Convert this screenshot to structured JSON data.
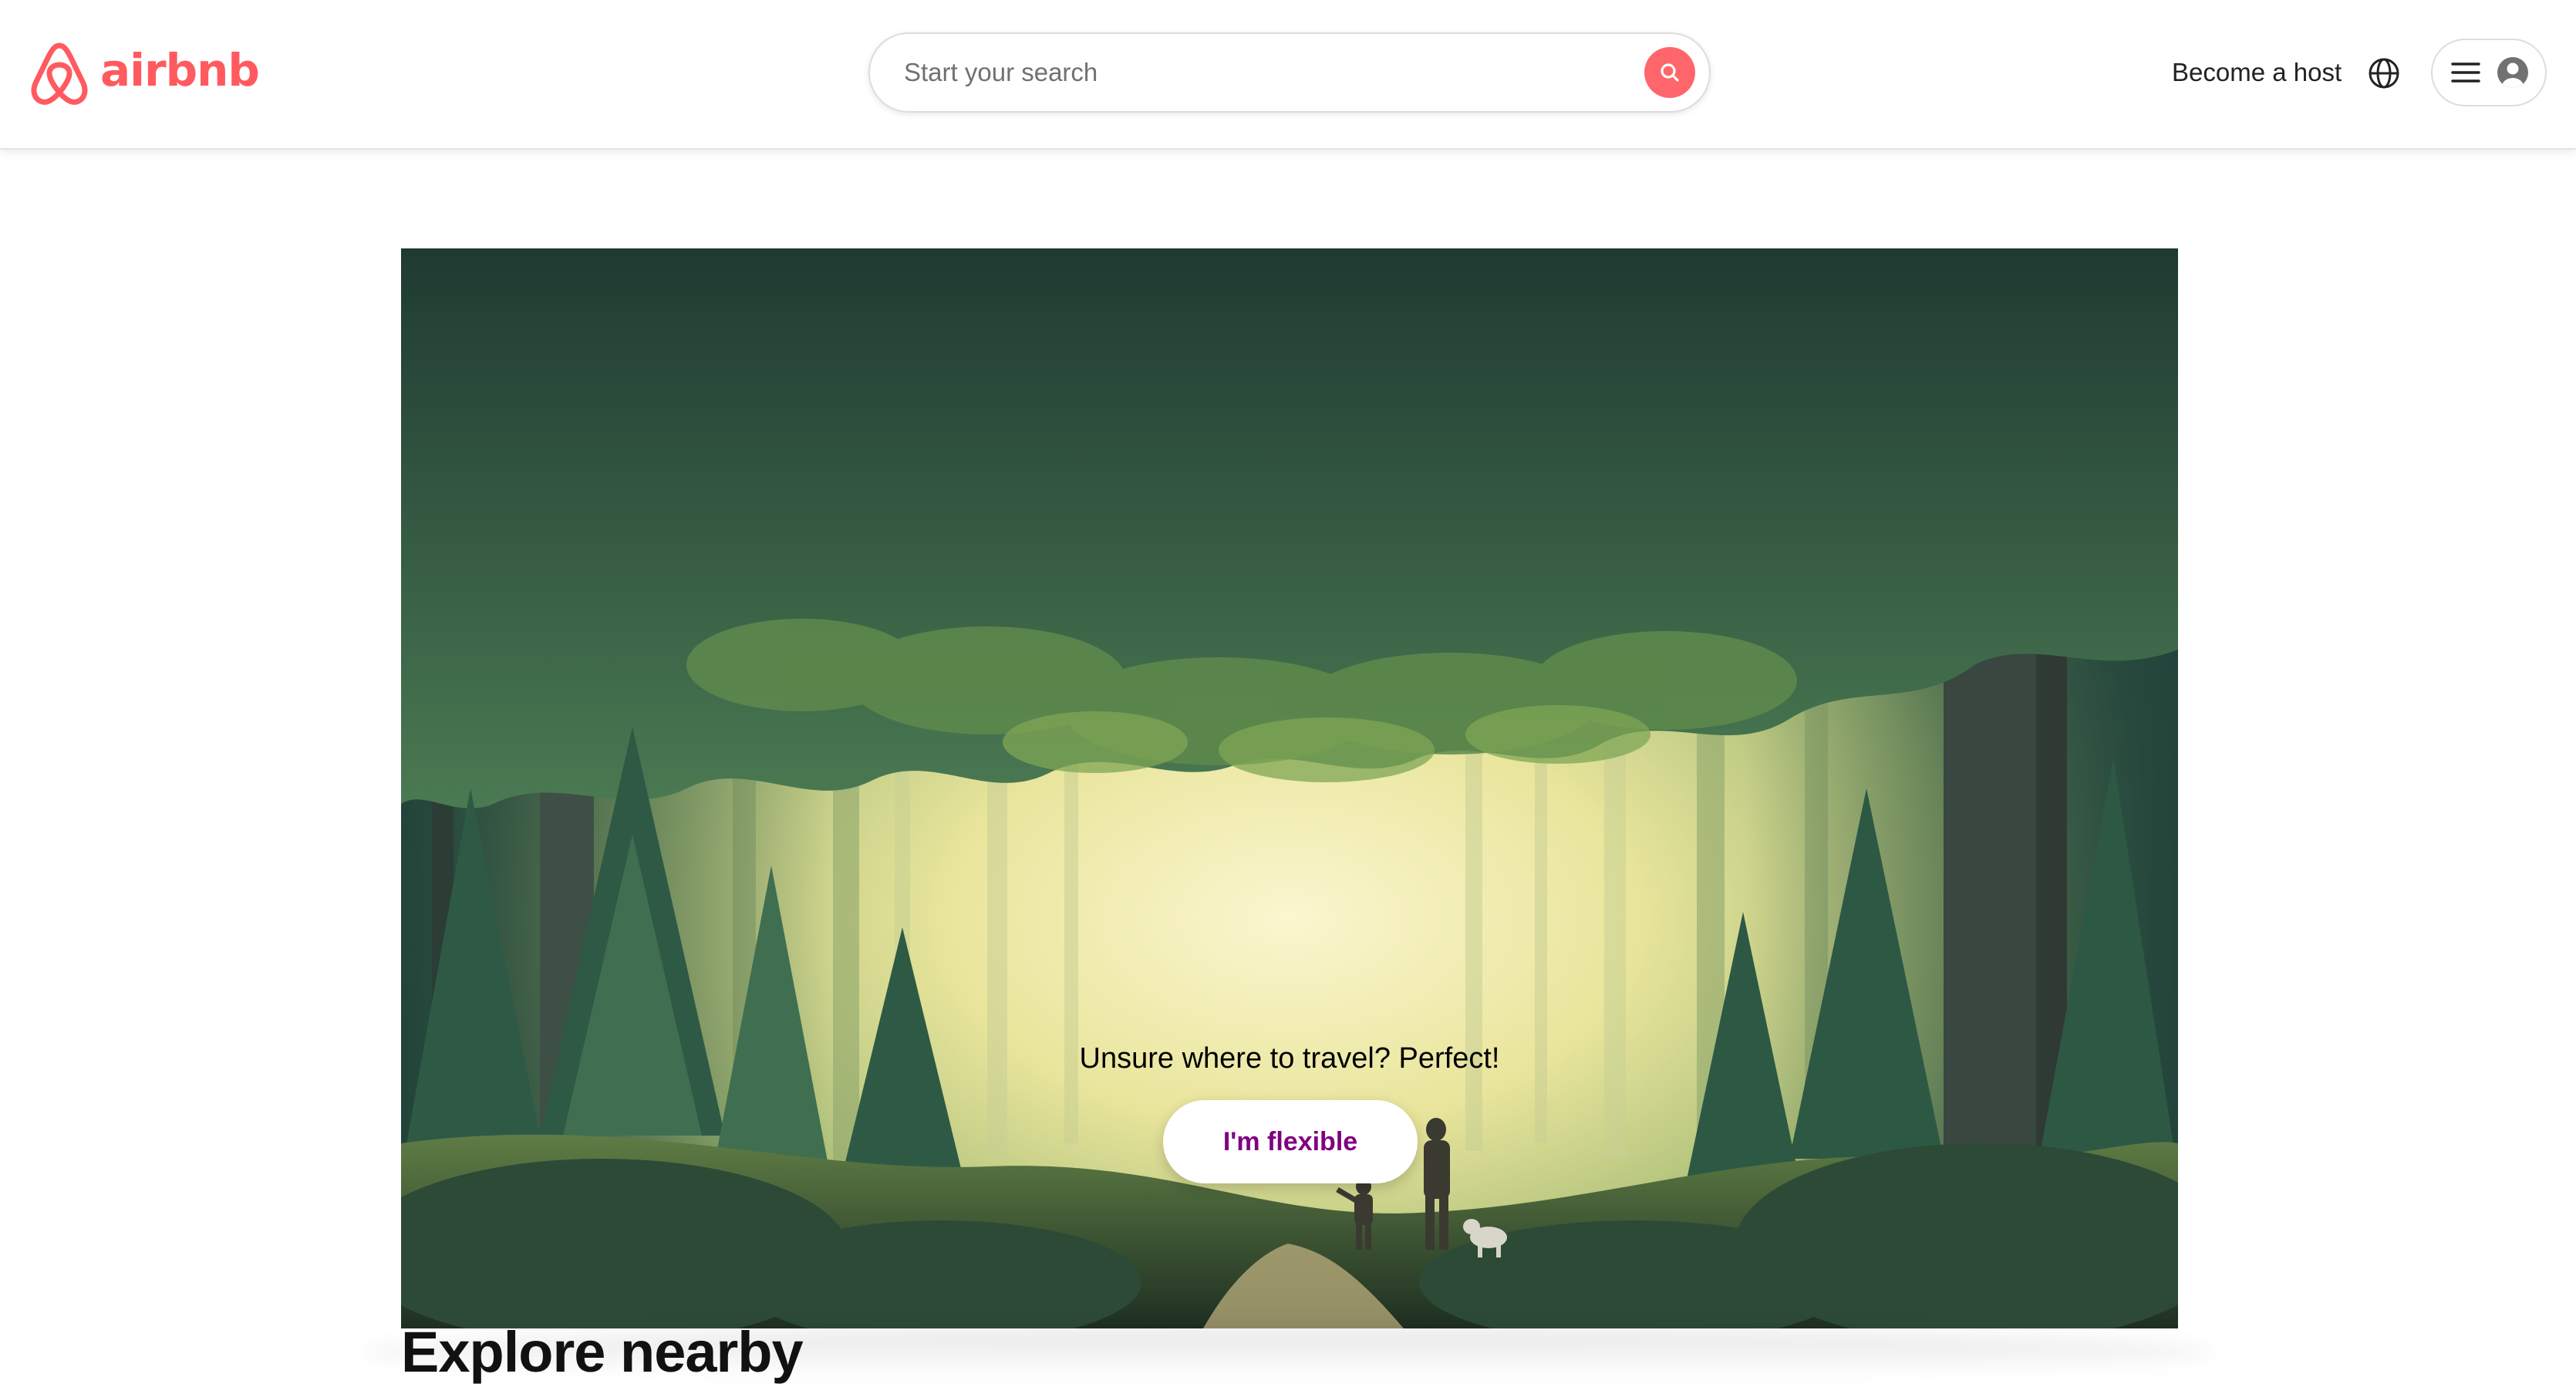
{
  "brand": {
    "name": "airbnb",
    "color": "#ff5a5f"
  },
  "header": {
    "search": {
      "placeholder": "Start your search",
      "value": "",
      "button_icon": "search-icon"
    },
    "become_host_label": "Become a host",
    "globe_icon": "globe-icon",
    "menu_icon": "hamburger-menu-icon",
    "avatar_icon": "user-avatar-icon"
  },
  "hero": {
    "tagline": "Unsure where to travel? Perfect!",
    "button_label": "I'm flexible",
    "button_text_color": "#800080",
    "background": "forest illustration"
  },
  "explore": {
    "title": "Explore nearby"
  }
}
